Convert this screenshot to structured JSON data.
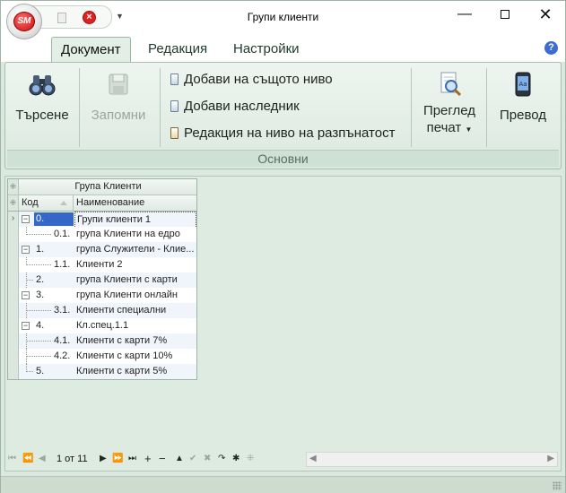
{
  "window": {
    "title": "Групи клиенти",
    "logo_text": "SM"
  },
  "ribbon": {
    "tabs": [
      {
        "label": "Документ",
        "active": true
      },
      {
        "label": "Редакция",
        "active": false
      },
      {
        "label": "Настройки",
        "active": false
      }
    ],
    "search_label": "Търсене",
    "save_label": "Запомни",
    "add_same_level_label": "Добави на същото ниво",
    "add_child_label": "Добави наследник",
    "edit_expanded_label": "Редакция на ниво на разпънатост",
    "print_preview_label_1": "Преглед",
    "print_preview_label_2": "печат",
    "translate_label": "Превод",
    "group_label": "Основни"
  },
  "grid": {
    "band_header": "Група Клиенти",
    "col_code": "Код",
    "col_name": "Наименование",
    "rows": [
      {
        "code": "0.",
        "name": "Групи клиенти 1"
      },
      {
        "code": "0.1.",
        "name": "група Клиенти на едро"
      },
      {
        "code": "1.",
        "name": "група Служители - Клие..."
      },
      {
        "code": "1.1.",
        "name": "Клиенти 2"
      },
      {
        "code": "2.",
        "name": "група Клиенти с карти"
      },
      {
        "code": "3.",
        "name": "група Клиенти онлайн"
      },
      {
        "code": "3.1.",
        "name": "Клиенти специални"
      },
      {
        "code": "4.",
        "name": "Кл.спец.1.1"
      },
      {
        "code": "4.1.",
        "name": "Клиенти с карти 7%"
      },
      {
        "code": "4.2.",
        "name": "Клиенти с карти 10%"
      },
      {
        "code": "5.",
        "name": "Клиенти с карти 5%"
      }
    ]
  },
  "navigator": {
    "position": "1 от 11"
  }
}
